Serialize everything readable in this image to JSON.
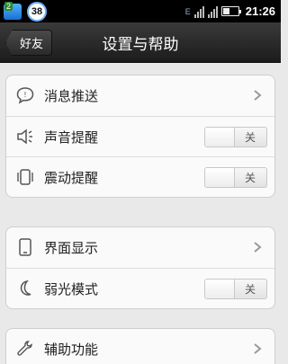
{
  "status_bar": {
    "app_badge": "2",
    "notification_count": "38",
    "network_label": "E",
    "time": "21:26"
  },
  "header": {
    "back_label": "好友",
    "title": "设置与帮助"
  },
  "groups": [
    {
      "items": [
        {
          "label": "消息推送",
          "icon": "speech-bubble-icon",
          "control": "chevron"
        },
        {
          "label": "声音提醒",
          "icon": "speaker-icon",
          "control": "toggle",
          "state": "关"
        },
        {
          "label": "震动提醒",
          "icon": "vibrate-icon",
          "control": "toggle",
          "state": "关"
        }
      ]
    },
    {
      "items": [
        {
          "label": "界面显示",
          "icon": "phone-icon",
          "control": "chevron"
        },
        {
          "label": "弱光模式",
          "icon": "moon-icon",
          "control": "toggle",
          "state": "关"
        }
      ]
    },
    {
      "items": [
        {
          "label": "辅助功能",
          "icon": "wrench-icon",
          "control": "chevron"
        }
      ]
    }
  ],
  "colors": {
    "background": "#e9e9e9",
    "titlebar": "#2a2a2a",
    "card": "#fafafa"
  }
}
